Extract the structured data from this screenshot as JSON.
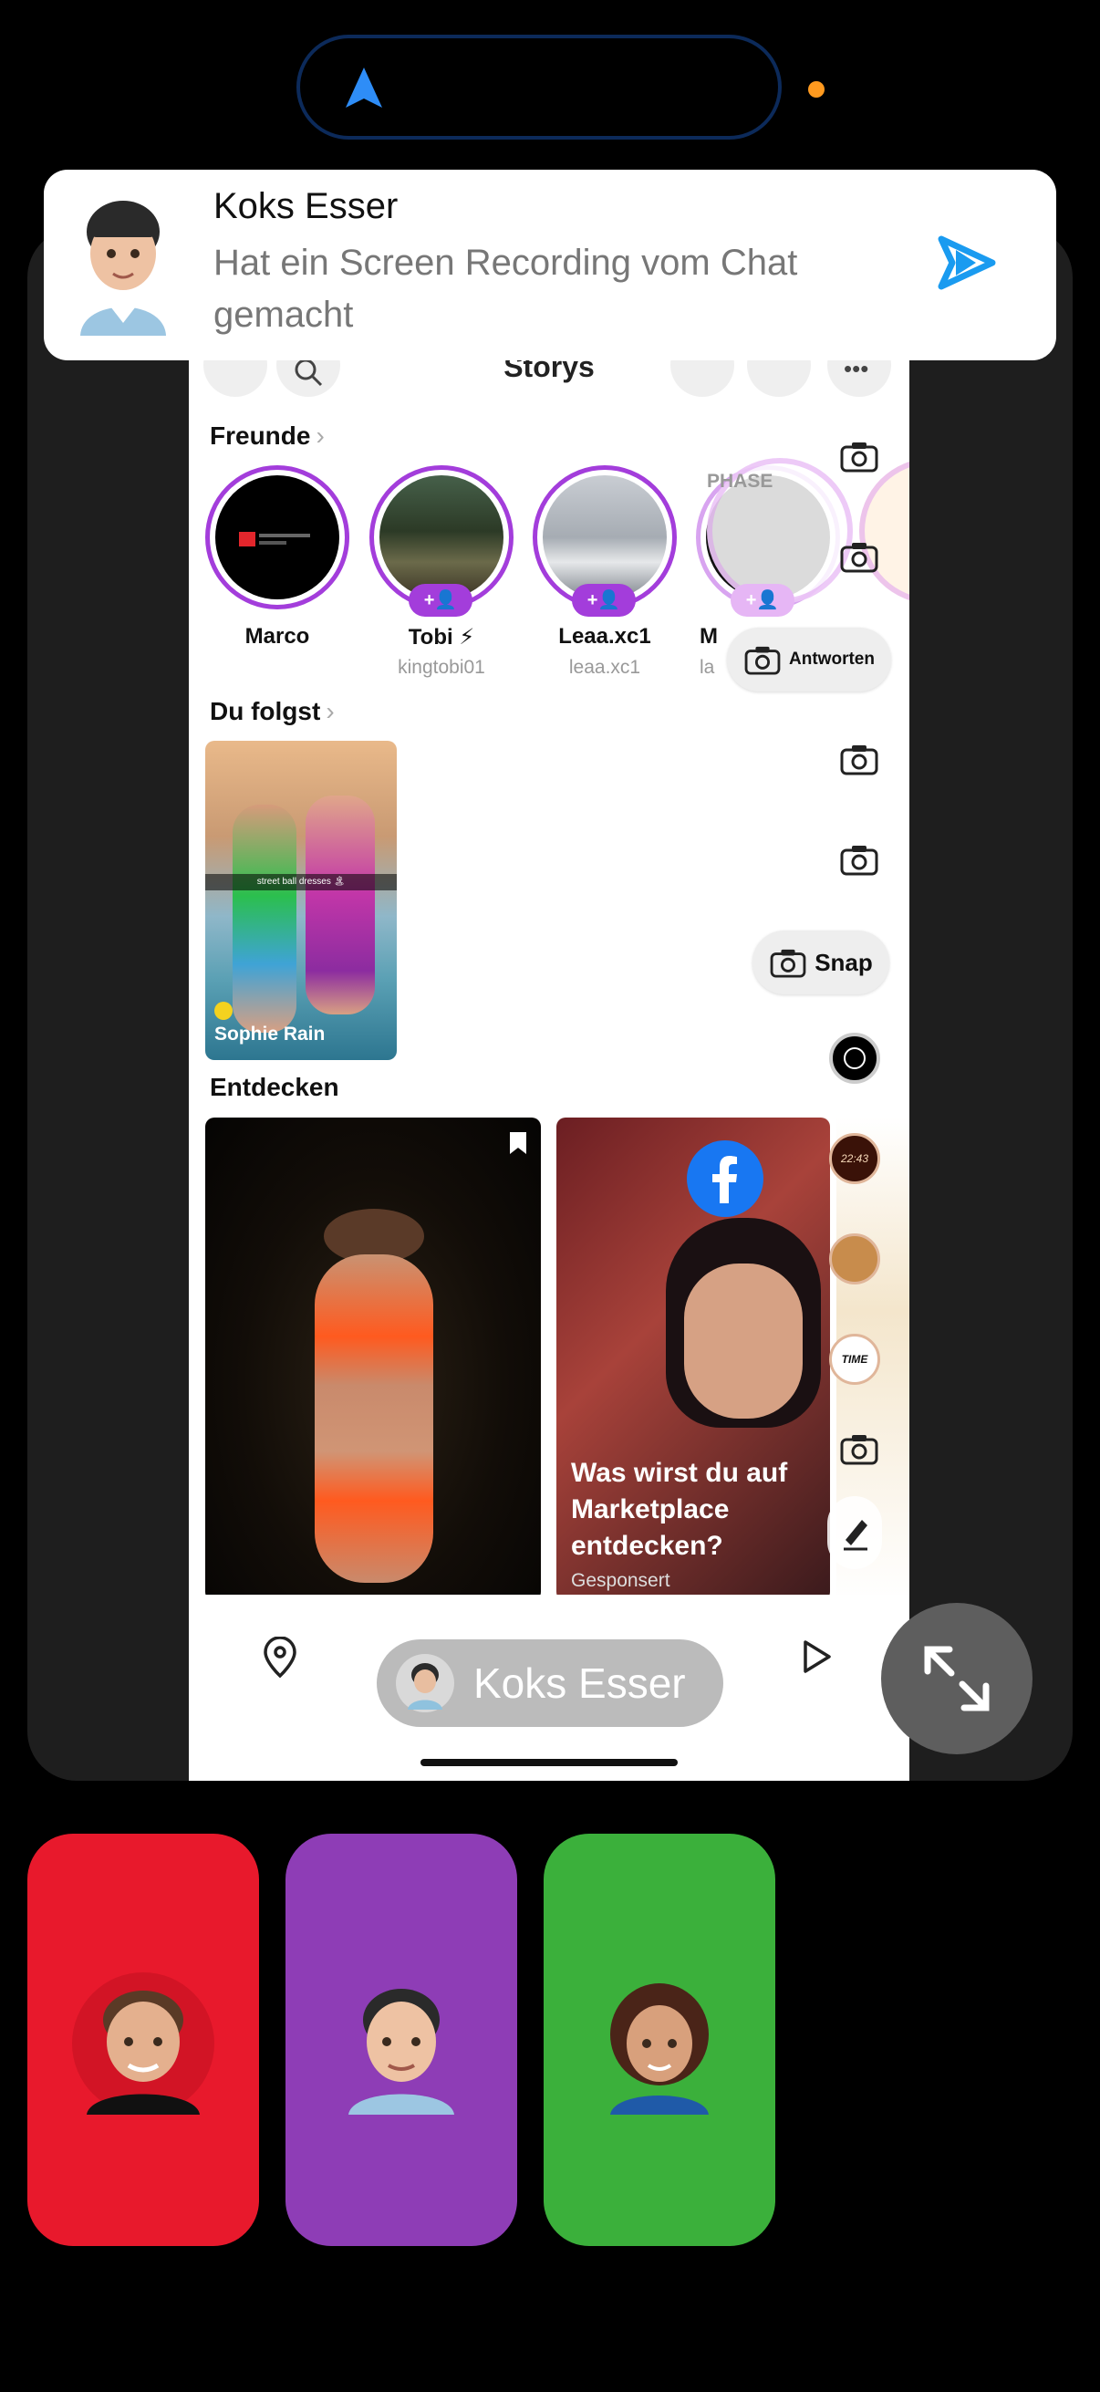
{
  "notification": {
    "sender": "Koks Esser",
    "message": "Hat ein Screen Recording vom Chat gemacht"
  },
  "storys_screen": {
    "title": "Storys",
    "friends_section": "Freunde",
    "friends": [
      {
        "name": "Marco",
        "username": ""
      },
      {
        "name": "Tobi ⚡",
        "username": "kingtobi01"
      },
      {
        "name": "Leaa.xc1",
        "username": "leaa.xc1"
      },
      {
        "name": "M",
        "username": "la"
      }
    ],
    "phase_label": "PHASE",
    "reply_button": "Antworten",
    "following_section": "Du folgst",
    "following": [
      {
        "name": "Sophie Rain",
        "caption": "street ball dresses 🏝"
      }
    ],
    "snap_button": "Snap",
    "discover_section": "Entdecken",
    "discover_tiles": [
      {
        "title": "",
        "sponsored": ""
      },
      {
        "title": "Was wirst du auf Marketplace entdecken?",
        "sponsored": "Gesponsert"
      }
    ],
    "side_stickers": [
      "22:43",
      "TIME"
    ]
  },
  "call": {
    "pill_name": "Koks Esser",
    "participants": [
      {
        "color": "#e8192c"
      },
      {
        "color": "#8e3db6"
      },
      {
        "color": "#3bb03b"
      }
    ]
  },
  "colors": {
    "snap_purple": "#a33ddb",
    "accent_blue": "#1a9bf0",
    "facebook_blue": "#1877f2"
  }
}
